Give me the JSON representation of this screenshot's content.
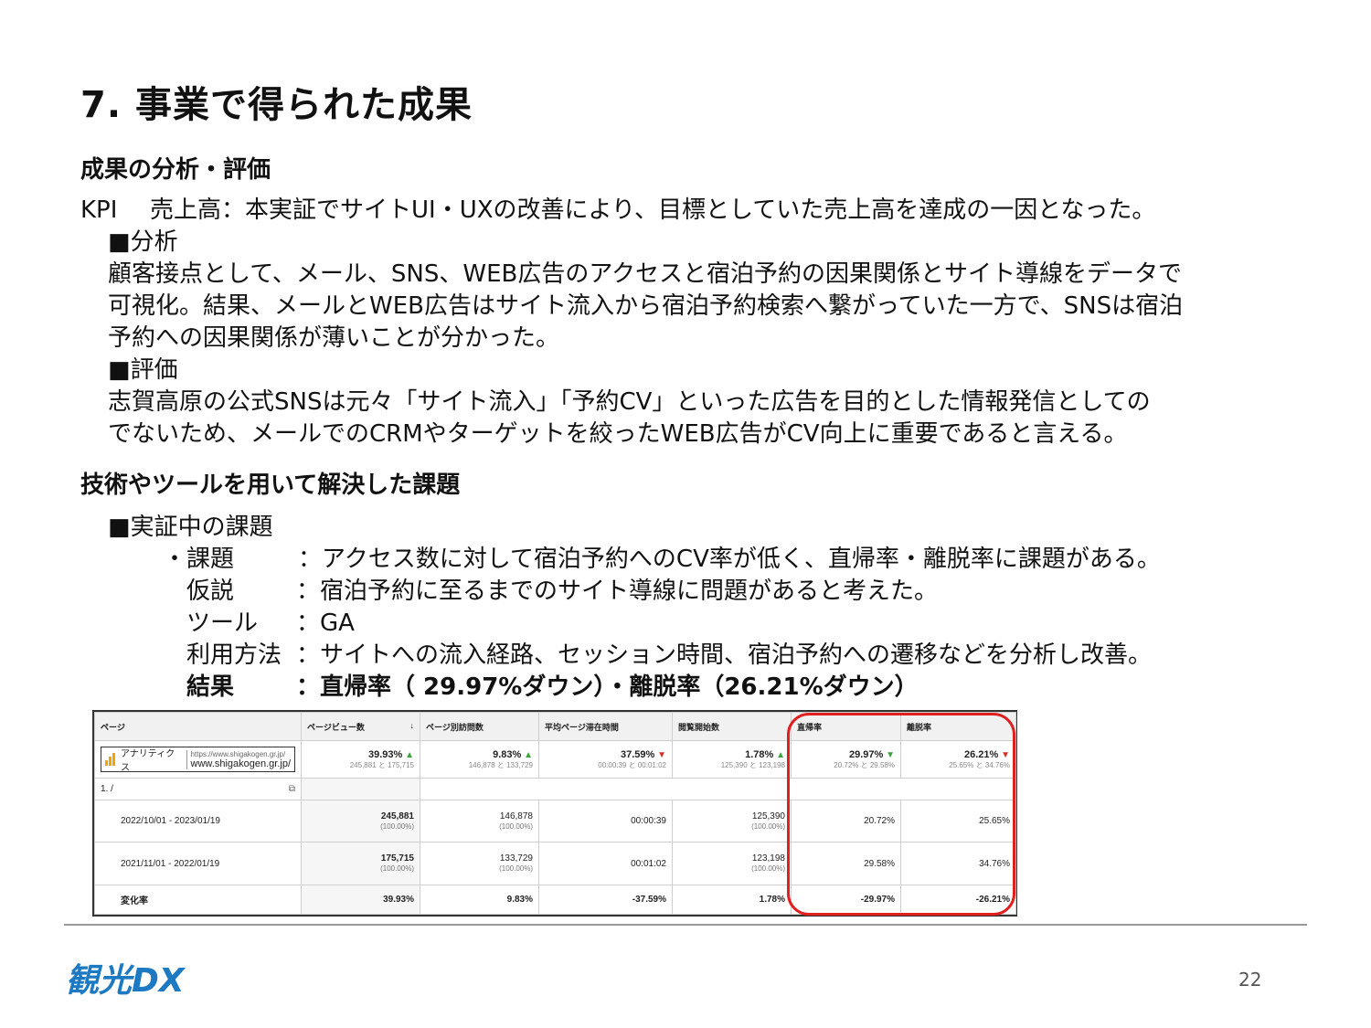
{
  "title": "7. 事業で得られた成果",
  "section1": {
    "heading": "成果の分析・評価",
    "kpi_label": "KPI",
    "kpi_text": "売上高：本実証でサイトUI・UXの改善により、目標としていた売上高を達成の一因となった。",
    "analysis_heading": "■分析",
    "analysis_lines": [
      "顧客接点として、メール、SNS、WEB広告のアクセスと宿泊予約の因果関係とサイト導線をデータで",
      "可視化。結果、メールとWEB広告はサイト流入から宿泊予約検索へ繋がっていた一方で、SNSは宿泊",
      "予約への因果関係が薄いことが分かった。"
    ],
    "evaluation_heading": "■評価",
    "evaluation_lines": [
      "志賀高原の公式SNSは元々「サイト流入」「予約CV」といった広告を目的とした情報発信としての",
      "でないため、メールでのCRMやターゲットを絞ったWEB広告がCV向上に重要であると言える。"
    ]
  },
  "section2": {
    "heading": "技術やツールを用いて解決した課題",
    "sub_heading": "■実証中の課題",
    "rows": [
      {
        "key": "・課題",
        "value": "：アクセス数に対して宿泊予約へのCV率が低く、直帰率・離脱率に課題がある。"
      },
      {
        "key": "仮説",
        "value": "：宿泊予約に至るまでのサイト導線に問題があると考えた。"
      },
      {
        "key": "ツール",
        "value": "：GA"
      },
      {
        "key": "利用方法",
        "value": "：サイトへの流入経路、セッション時間、宿泊予約への遷移などを分析し改善。"
      },
      {
        "key": "結果",
        "value": "：直帰率（ 29.97%ダウン）・離脱率（26.21%ダウン）"
      }
    ]
  },
  "ga_table": {
    "headers": [
      "ページ",
      "ページビュー数",
      "ページ別訪問数",
      "平均ページ滞在時間",
      "閲覧開始数",
      "直帰率",
      "離脱率"
    ],
    "summary": {
      "logo_text": "アナリティクス",
      "site_url_small": "https://www.shigakogen.gr.jp/",
      "site_url": "www.shigakogen.gr.jp/",
      "cells": [
        {
          "pct": "39.93%",
          "dir": "up",
          "cmp": "245,881 と 175,715"
        },
        {
          "pct": "9.83%",
          "dir": "up",
          "cmp": "146,878 と 133,729"
        },
        {
          "pct": "37.59%",
          "dir": "down",
          "cmp": "00:00:39 と 00:01:02"
        },
        {
          "pct": "1.78%",
          "dir": "up",
          "cmp": "125,390 と 123,198"
        },
        {
          "pct": "29.97%",
          "dir": "down-good",
          "cmp": "20.72% と 29.58%"
        },
        {
          "pct": "26.21%",
          "dir": "down",
          "cmp": "25.65% と 34.76%"
        }
      ]
    },
    "page_row": "1.  /",
    "rows": [
      {
        "label": "2022/10/01 - 2023/01/19",
        "pv": "245,881",
        "pv_sub": "(100.00%)",
        "uv": "146,878",
        "uv_sub": "(100.00%)",
        "time": "00:00:39",
        "ent": "125,390",
        "ent_sub": "(100.00%)",
        "bounce": "20.72%",
        "exit": "25.65%"
      },
      {
        "label": "2021/11/01 - 2022/01/19",
        "pv": "175,715",
        "pv_sub": "(100.00%)",
        "uv": "133,729",
        "uv_sub": "(100.00%)",
        "time": "00:01:02",
        "ent": "123,198",
        "ent_sub": "(100.00%)",
        "bounce": "29.58%",
        "exit": "34.76%"
      },
      {
        "label": "変化率",
        "pv": "39.93%",
        "uv": "9.83%",
        "time": "-37.59%",
        "ent": "1.78%",
        "bounce": "-29.97%",
        "exit": "-26.21%"
      }
    ]
  },
  "footer": {
    "brand": "観光DX",
    "page_number": "22"
  }
}
